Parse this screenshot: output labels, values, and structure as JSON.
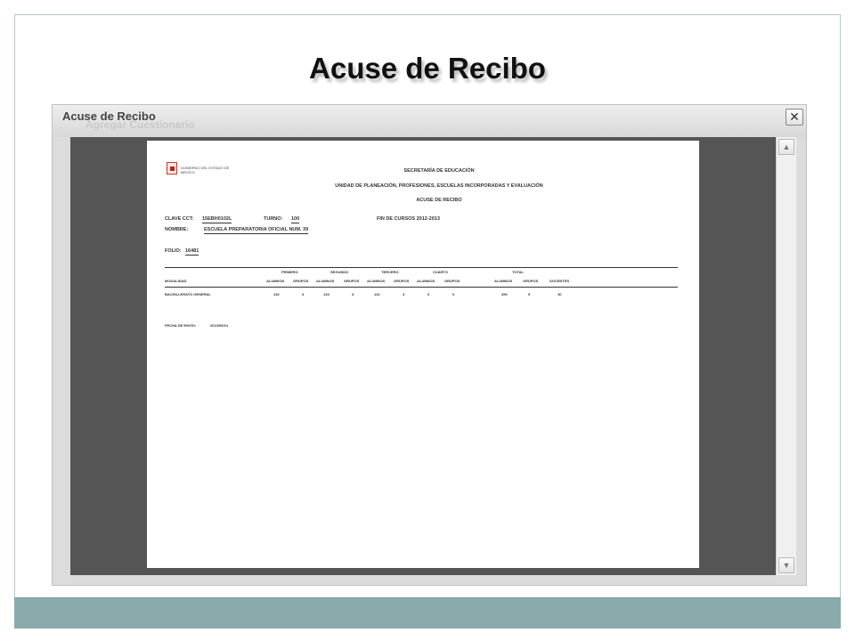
{
  "slide": {
    "title": "Acuse de Recibo"
  },
  "dialog": {
    "title": "Acuse de Recibo",
    "background_text": "Agregar Cuestionario",
    "close_glyph": "✕"
  },
  "document": {
    "logo_text": "GOBIERNO DEL ESTADO DE MÉXICO",
    "header_1": "SECRETARÍA DE EDUCACIÓN",
    "header_2": "UNIDAD DE PLANEACIÓN, PROFESIONES, ESCUELAS INCORPORADAS Y EVALUACIÓN",
    "header_3": "ACUSE DE RECIBO",
    "clave_label": "CLAVE CCT:",
    "clave_value": "15EBH0102L",
    "turno_label": "TURNO:",
    "turno_value": "100",
    "fin_cursos": "FIN DE CURSOS 2012-2013",
    "nombre_label": "NOMBRE:",
    "nombre_value": "ESCUELA PREPARATORIA OFICIAL NUM. 39",
    "folio_label": "FOLIO:",
    "folio_value": "16481",
    "group_headers": [
      "PRIMERO",
      "SEGUNDO",
      "TERCERO",
      "CUARTO",
      "TOTAL"
    ],
    "columns": [
      "MODALIDAD",
      "ALUMNOS",
      "GRUPOS",
      "ALUMNOS",
      "GRUPOS",
      "ALUMNOS",
      "GRUPOS",
      "ALUMNOS",
      "GRUPOS",
      "ALUMNOS",
      "GRUPOS",
      "DOCENTES"
    ],
    "row": [
      "BACHILLERATO GENERAL",
      "132",
      "3",
      "133",
      "3",
      "131",
      "3",
      "0",
      "0",
      "396",
      "9",
      "30"
    ],
    "fecha_label": "FECHA DE ENVÍO:",
    "fecha_value": "2013/05/14"
  },
  "colors": {
    "band": "#8aabab",
    "viewer_bg": "#555555"
  }
}
